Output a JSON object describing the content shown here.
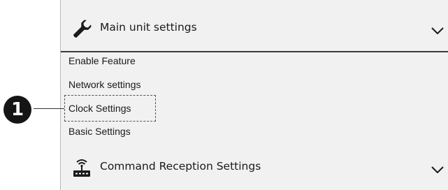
{
  "main_section": {
    "title": "Main unit settings",
    "icon": "wrench-icon",
    "expanded": true
  },
  "menu": {
    "items": [
      {
        "label": "Enable Feature"
      },
      {
        "label": "Network settings"
      },
      {
        "label": "Clock Settings"
      },
      {
        "label": "Basic Settings"
      }
    ],
    "focused_index": 2
  },
  "command_section": {
    "title": "Command Reception Settings",
    "icon": "wireless-router-icon",
    "expanded": false
  },
  "callout": {
    "number": "1"
  },
  "colors": {
    "panel_background": "#f1f1f1",
    "text": "#1a1a1a",
    "callout": "#151515"
  }
}
